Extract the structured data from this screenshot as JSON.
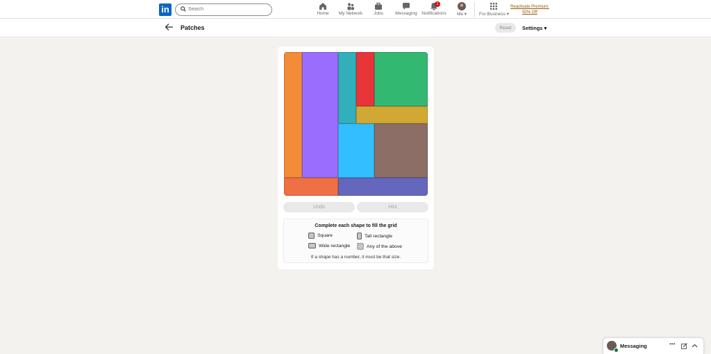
{
  "nav": {
    "logo_text": "in",
    "search_placeholder": "Search",
    "items": [
      {
        "label": "Home",
        "icon": "home-icon"
      },
      {
        "label": "My Network",
        "icon": "network-icon"
      },
      {
        "label": "Jobs",
        "icon": "jobs-icon"
      },
      {
        "label": "Messaging",
        "icon": "messaging-icon"
      },
      {
        "label": "Notifications",
        "icon": "bell-icon",
        "badge": "1"
      },
      {
        "label": "Me",
        "icon": "avatar"
      },
      {
        "label": "For Business",
        "icon": "grid-icon"
      }
    ],
    "premium_line1": "Reactivate Premium:",
    "premium_line2": "50% Off"
  },
  "header": {
    "title": "Patches",
    "reset_label": "Reset",
    "settings_label": "Settings"
  },
  "game": {
    "colors": {
      "orange": "#f28c38",
      "purple": "#9a6dff",
      "teal": "#33aebb",
      "red": "#e8353a",
      "green": "#33b872",
      "gold": "#d1a833",
      "sky": "#33bfff",
      "brown": "#8c6e66",
      "coral": "#ee7044",
      "indigo": "#6467bd"
    },
    "undo_label": "Undo",
    "hint_label": "Hint"
  },
  "rules": {
    "title": "Complete each shape to fill the grid",
    "square": "Square",
    "tall": "Tall rectangle",
    "wide": "Wide rectangle",
    "any": "Any of the above",
    "note": "If a shape has a number, it must be that size."
  },
  "messaging": {
    "label": "Messaging"
  }
}
